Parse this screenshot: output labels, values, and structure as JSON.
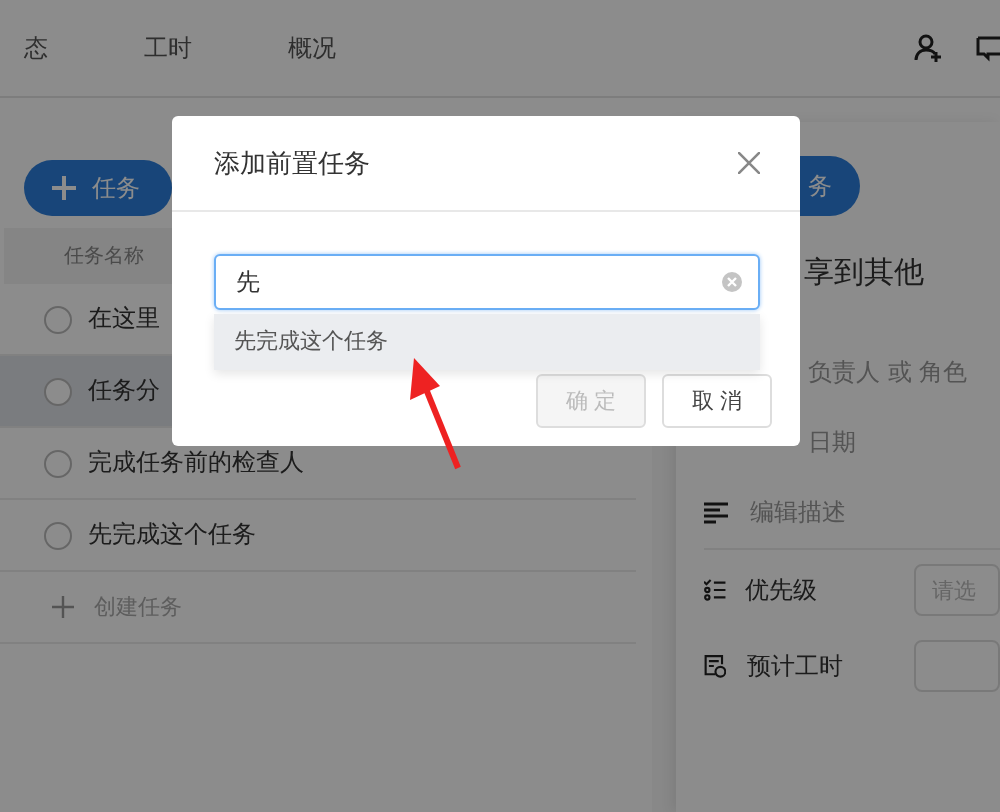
{
  "nav": {
    "tabs": [
      {
        "label": "态"
      },
      {
        "label": "工时"
      },
      {
        "label": "概况"
      }
    ]
  },
  "tasks": {
    "add_button": "任务",
    "column": "任务名称",
    "rows": [
      {
        "title": "在这里",
        "selected": false
      },
      {
        "title": "任务分",
        "selected": true
      },
      {
        "title": "完成任务前的检查人",
        "selected": false
      },
      {
        "title": "先完成这个任务",
        "selected": false
      }
    ],
    "create": "创建任务"
  },
  "detail": {
    "action_button": "务",
    "title": "享到其他",
    "assignee_hint": "负责人 或 角色",
    "date_hint": "日期",
    "description_hint": "编辑描述",
    "fields": [
      {
        "kind": "priority",
        "label": "优先级",
        "placeholder": "请选"
      },
      {
        "kind": "hours",
        "label": "预计工时"
      }
    ]
  },
  "dialog": {
    "title": "添加前置任务",
    "search": {
      "value": "先"
    },
    "suggestions": [
      {
        "label": "先完成这个任务",
        "selected": true
      }
    ],
    "buttons": [
      {
        "label": "确 定",
        "disabled": true
      },
      {
        "label": "取 消",
        "disabled": false
      }
    ]
  }
}
